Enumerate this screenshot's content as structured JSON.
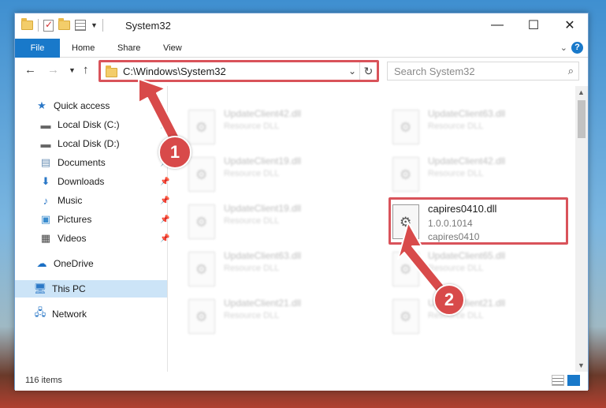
{
  "window": {
    "title": "System32",
    "controls": {
      "minimize": "—",
      "maximize": "☐",
      "close": "✕"
    }
  },
  "ribbon": {
    "tabs": [
      "File",
      "Home",
      "Share",
      "View"
    ],
    "help": "?"
  },
  "address_bar": {
    "path": "C:\\Windows\\System32",
    "search_placeholder": "Search System32"
  },
  "sidebar": {
    "items": [
      {
        "label": "Quick access",
        "icon": "star-icon"
      },
      {
        "label": "Local Disk (C:)",
        "icon": "drive-icon",
        "pinned": true
      },
      {
        "label": "Local Disk (D:)",
        "icon": "drive-icon",
        "pinned": true
      },
      {
        "label": "Documents",
        "icon": "documents-icon",
        "pinned": true
      },
      {
        "label": "Downloads",
        "icon": "download-icon",
        "pinned": true
      },
      {
        "label": "Music",
        "icon": "music-icon",
        "pinned": true
      },
      {
        "label": "Pictures",
        "icon": "pictures-icon",
        "pinned": true
      },
      {
        "label": "Videos",
        "icon": "videos-icon",
        "pinned": true
      },
      {
        "label": "OneDrive",
        "icon": "cloud-icon"
      },
      {
        "label": "This PC",
        "icon": "computer-icon",
        "selected": true
      },
      {
        "label": "Network",
        "icon": "network-icon"
      }
    ]
  },
  "files": {
    "background_items": [
      {
        "name": "UpdateClient42.dll",
        "type": "Resource DLL"
      },
      {
        "name": "UpdateClient63.dll",
        "type": "Resource DLL"
      },
      {
        "name": "UpdateClient19.dll",
        "type": "Resource DLL"
      },
      {
        "name": "UpdateClient42.dll",
        "type": "Resource DLL"
      },
      {
        "name": "UpdateClient19.dll",
        "type": "Resource DLL"
      },
      {
        "name": "UpdateClient63.dll",
        "type": "Resource DLL"
      },
      {
        "name": "UpdateClient65.dll",
        "type": "Resource DLL"
      },
      {
        "name": "UpdateClient21.dll",
        "type": "Resource DLL"
      },
      {
        "name": "UpdateClient21.dll",
        "type": "Resource DLL"
      }
    ],
    "highlighted": {
      "name": "capires0410.dll",
      "version": "1.0.0.1014",
      "description": "capires0410"
    }
  },
  "status": {
    "item_count": "116 items"
  },
  "annotations": {
    "callout_1": "1",
    "callout_2": "2",
    "highlight_color": "#d9535a"
  }
}
